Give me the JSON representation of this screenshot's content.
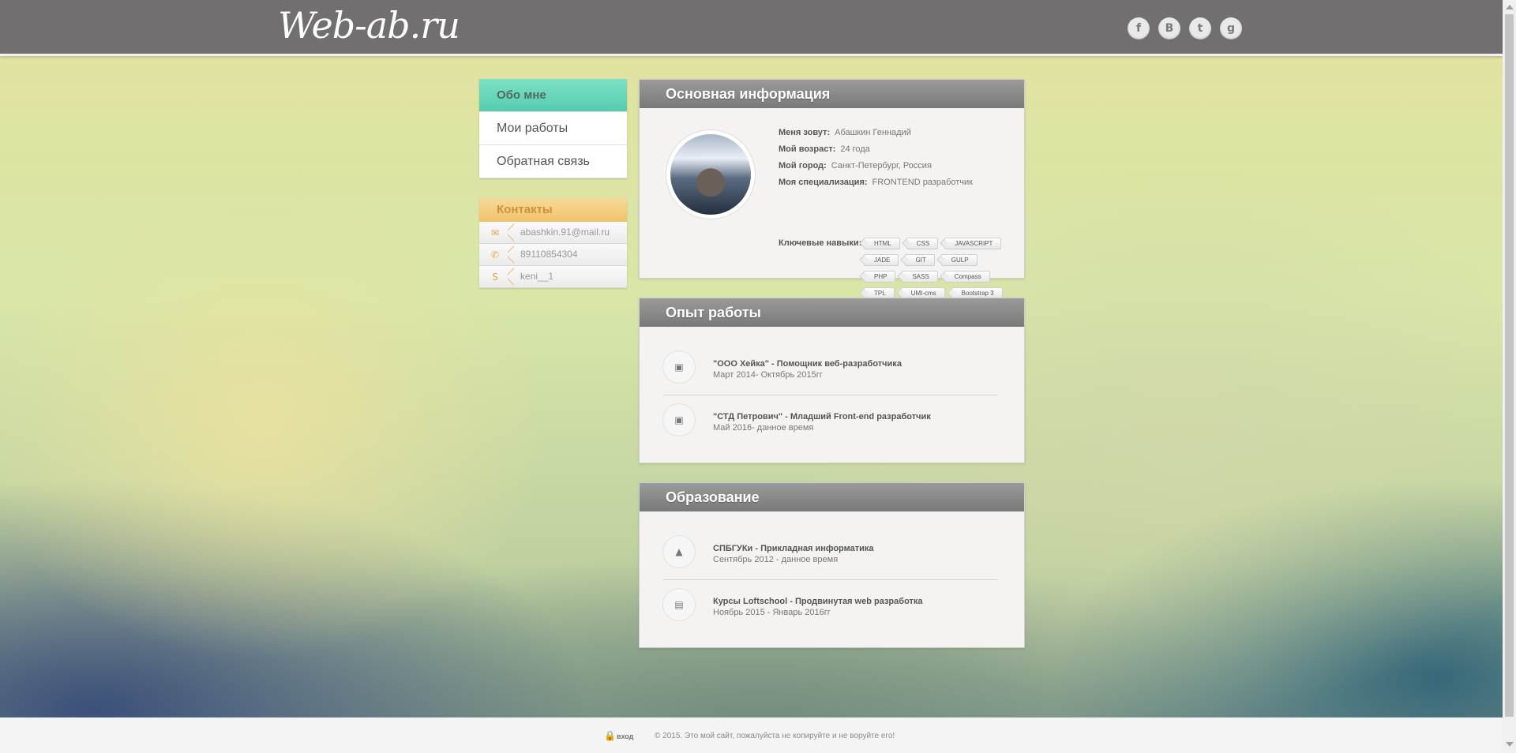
{
  "header": {
    "logo_text": "Web-ab.ru",
    "socials": [
      {
        "icon": "facebook-icon",
        "glyph": "f"
      },
      {
        "icon": "vk-icon",
        "glyph": "B"
      },
      {
        "icon": "twitter-icon",
        "glyph": "t"
      },
      {
        "icon": "github-icon",
        "glyph": "g"
      }
    ]
  },
  "nav": {
    "items": [
      {
        "label": "Обо мне",
        "active": true
      },
      {
        "label": "Мои работы",
        "active": false
      },
      {
        "label": "Обратная связь",
        "active": false
      }
    ]
  },
  "contacts": {
    "title": "Контакты",
    "items": [
      {
        "icon": "mail-icon",
        "glyph": "✉",
        "text": "abashkin.91@mail.ru"
      },
      {
        "icon": "phone-icon",
        "glyph": "✆",
        "text": "89110854304"
      },
      {
        "icon": "skype-icon",
        "glyph": "S",
        "text": "keni__1"
      }
    ]
  },
  "info": {
    "title": "Основная информация",
    "rows": [
      {
        "key": "Меня зовут:",
        "value": "Абашкин Геннадий"
      },
      {
        "key": "Мой возраст:",
        "value": "24 года"
      },
      {
        "key": "Мой город:",
        "value": "Санкт-Петербург, Россия"
      },
      {
        "key": "Моя специализация:",
        "value": "FRONTEND разработчик"
      }
    ],
    "skills_label": "Ключевые навыки:",
    "skills": [
      "HTML",
      "CSS",
      "JAVASCRIPT",
      "JADE",
      "GIT",
      "GULP",
      "PHP",
      "SASS",
      "Compass",
      "TPL",
      "UMI-cms",
      "Bootstrap 3"
    ]
  },
  "experience": {
    "title": "Опыт работы",
    "items": [
      {
        "icon": "briefcase-icon",
        "title": "\"ООО Хейка\" - Помощник веб-разработчика",
        "date": "Март 2014- Октябрь 2015гг"
      },
      {
        "icon": "briefcase-icon",
        "title": "\"СТД Петрович\" - Младший Front-end разработчик",
        "date": "Май 2016- данное время"
      }
    ]
  },
  "education": {
    "title": "Образование",
    "items": [
      {
        "icon": "graduation-cap-icon",
        "title": "СПБГУКи - Прикладная информатика",
        "date": "Сентябрь 2012 - данное время"
      },
      {
        "icon": "document-icon",
        "title": "Курсы Loftschool - Продвинутая web разработка",
        "date": "Ноябрь 2015 - Январь 2016гг"
      }
    ]
  },
  "footer": {
    "login_label": "вход",
    "copyright": "© 2015. Это мой сайт, пожалуйста не копируйте и не воруйте его!"
  }
}
